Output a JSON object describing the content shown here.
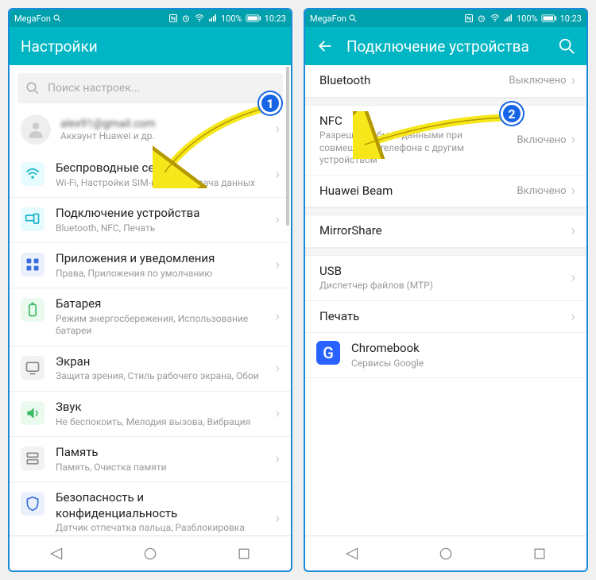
{
  "status": {
    "carrier": "MegaFon",
    "battery": "100%",
    "time": "10:23"
  },
  "left": {
    "title": "Настройки",
    "search_placeholder": "Поиск настроек...",
    "account_email": "alex91@gmail.com",
    "account_sub": "Аккаунт Huawei и др.",
    "items": [
      {
        "title": "Беспроводные сети",
        "sub": "Wi-Fi, Настройки SIM-карт, Передача данных",
        "color": "#17b4c8"
      },
      {
        "title": "Подключение устройства",
        "sub": "Bluetooth, NFC, Печать",
        "color": "#17b4c8"
      },
      {
        "title": "Приложения и уведомления",
        "sub": "Права, Приложения по умолчанию",
        "color": "#3a6fd8"
      },
      {
        "title": "Батарея",
        "sub": "Режим энергосбережения, Использование батареи",
        "color": "#3dbb67"
      },
      {
        "title": "Экран",
        "sub": "Защита зрения, Стиль рабочего экрана, Обои",
        "color": "#888"
      },
      {
        "title": "Звук",
        "sub": "Не беспокоить, Мелодия вызова, Вибрация",
        "color": "#3dbb67"
      },
      {
        "title": "Память",
        "sub": "Память, Очистка памяти",
        "color": "#888"
      },
      {
        "title": "Безопасность и конфиденциальность",
        "sub": "Датчик отпечатка пальца, Разблокировка распознаванием лица, Защитник экрана",
        "color": "#3a6fd8"
      }
    ]
  },
  "right": {
    "title": "Подключение устройства",
    "items": [
      {
        "title": "Bluetooth",
        "sub": "",
        "value": "Выключено"
      },
      {
        "title": "NFC",
        "sub": "Разрешить обмен данными при совмещении телефона с другим устройством",
        "value": "Включено"
      },
      {
        "title": "Huawei Beam",
        "sub": "",
        "value": "Включено"
      },
      {
        "title": "MirrorShare",
        "sub": "",
        "value": ""
      },
      {
        "title": "USB",
        "sub": "Диспетчер файлов (MTP)",
        "value": ""
      },
      {
        "title": "Печать",
        "sub": "",
        "value": ""
      },
      {
        "title": "Chromebook",
        "sub": "Сервисы Google",
        "value": "",
        "chrome": true
      }
    ]
  },
  "annotations": {
    "b1": "1",
    "b2": "2"
  }
}
